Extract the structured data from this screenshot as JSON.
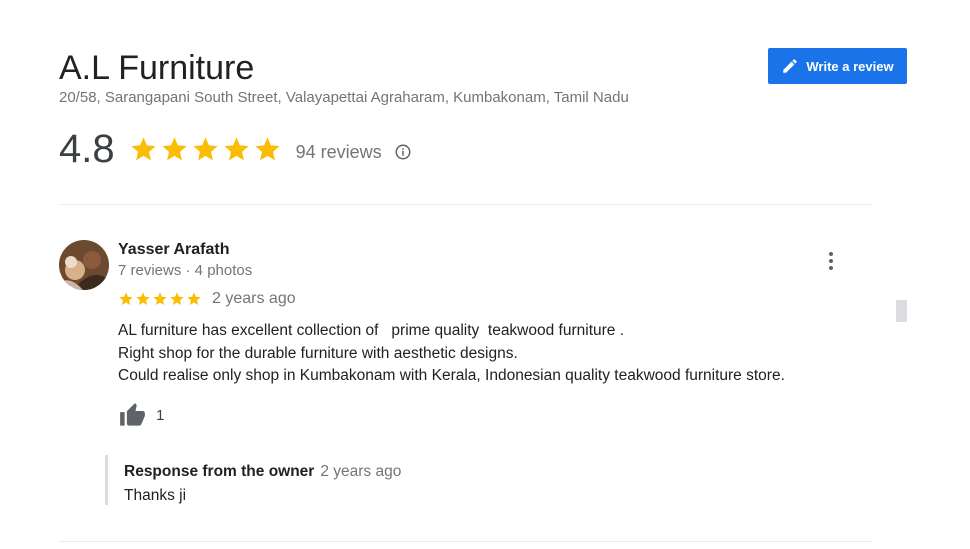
{
  "business": {
    "name": "A.L Furniture",
    "address": "20/58, Sarangapani South Street, Valayapettai Agraharam, Kumbakonam, Tamil Nadu",
    "rating": "4.8",
    "stars": 5,
    "reviews_label": "94 reviews",
    "write_review_label": "Write a review"
  },
  "review": {
    "reviewer_name": "Yasser Arafath",
    "reviewer_meta": "7 reviews · 4 photos",
    "stars": 5,
    "date": "2 years ago",
    "text": "AL furniture has excellent collection of   prime quality  teakwood furniture .\nRight shop for the durable furniture with aesthetic designs.\nCould realise only shop in Kumbakonam with Kerala, Indonesian quality teakwood furniture store.",
    "likes": "1",
    "owner_response": {
      "label": "Response from the owner",
      "date": "2 years ago",
      "text": "Thanks ji"
    }
  },
  "icons": {
    "star": "star-icon",
    "info": "info-icon",
    "pencil": "pencil-icon",
    "more": "more-vert-icon",
    "thumb": "thumb-up-icon"
  },
  "colors": {
    "accent": "#1a73e8",
    "star": "#fbbc04",
    "secondary_text": "#70757a"
  }
}
